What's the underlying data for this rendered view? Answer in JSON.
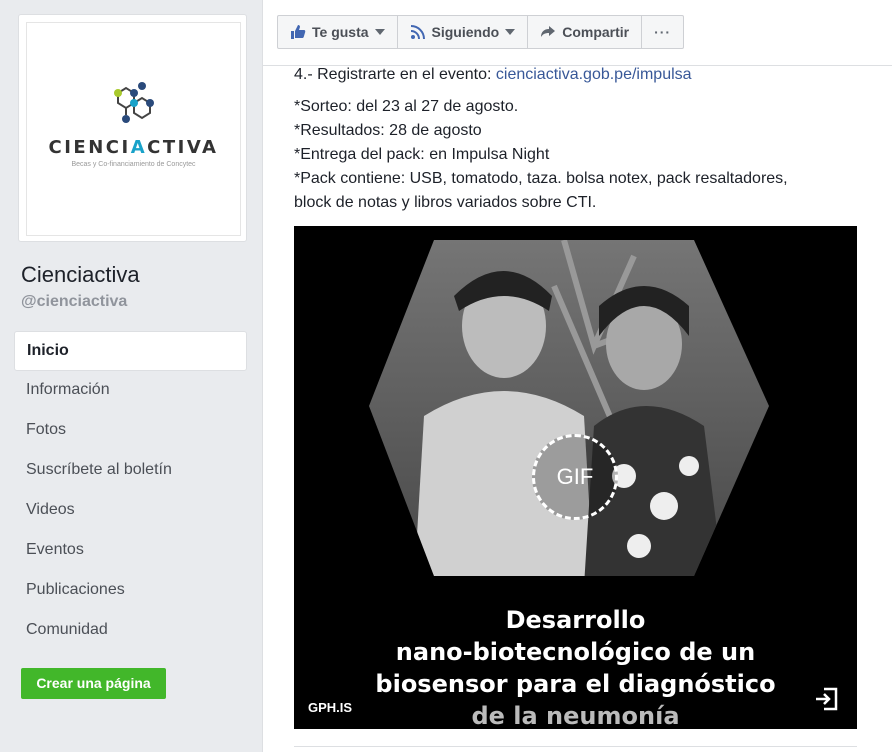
{
  "sidebar": {
    "logo": {
      "word_prefix": "CIENCI",
      "word_accent": "A",
      "word_suffix": "CTIVA",
      "tagline": "Becas y Co-financiamiento de Concytec"
    },
    "page_name": "Cienciactiva",
    "page_handle": "@cienciactiva",
    "nav": [
      "Inicio",
      "Información",
      "Fotos",
      "Suscríbete al boletín",
      "Videos",
      "Eventos",
      "Publicaciones",
      "Comunidad"
    ],
    "active_nav": "Inicio",
    "create_page_label": "Crear una página"
  },
  "toolbar": {
    "like_label": "Te gusta",
    "following_label": "Siguiendo",
    "share_label": "Compartir",
    "more_label": "···"
  },
  "post": {
    "step4_text": "4.- Registrarte en el evento: ",
    "step4_link": "cienciactiva.gob.pe/impulsa",
    "lines": [
      "*Sorteo: del 23 al 27 de agosto.",
      "*Resultados: 28 de agosto",
      "*Entrega del pack: en Impulsa Night",
      "*Pack contiene: USB, tomatodo, taza. bolsa notex, pack resaltadores,",
      "block de notas y libros variados sobre CTI."
    ],
    "media": {
      "gif_label": "GIF",
      "caption_lines": [
        "Desarrollo",
        "nano-biotecnológico de un",
        "biosensor para el diagnóstico",
        "de la neumonía"
      ],
      "source": "GPH.IS"
    }
  },
  "colors": {
    "accent_blue": "#19a2c9",
    "link": "#385898",
    "create_green": "#42b72a",
    "like_blue": "#4267b2"
  }
}
